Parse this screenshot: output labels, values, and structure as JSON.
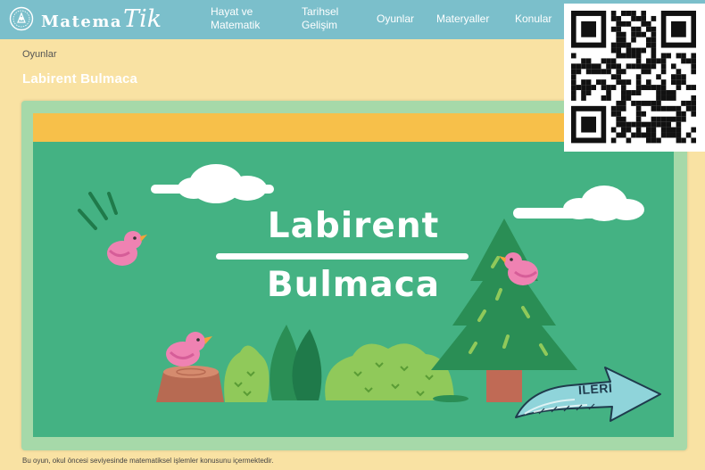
{
  "header": {
    "logo": {
      "main": "Matema",
      "accent": "Tik"
    },
    "nav": [
      {
        "line1": "Hayat ve",
        "line2": "Matematik"
      },
      {
        "line1": "Tarihsel",
        "line2": "Gelişim"
      },
      {
        "line1": "Oyunlar",
        "line2": ""
      },
      {
        "line1": "Materyaller",
        "line2": ""
      },
      {
        "line1": "Konular",
        "line2": ""
      }
    ]
  },
  "breadcrumb": "Oyunlar",
  "page_title": "Labirent Bulmaca",
  "game": {
    "title_line1": "Labirent",
    "title_line2": "Bulmaca",
    "next_button": "İLERİ"
  },
  "footer_note": "Bu oyun, okul öncesi seviyesinde matematiksel işlemler konusunu içermektedir.",
  "colors": {
    "navbar": "#7bbfcb",
    "page_background": "#f9e2a3",
    "game_board": "#44b283",
    "game_band": "#f7c04a",
    "bird": "#ef82b2",
    "tree": "#2a8e55",
    "next_arrow": "#8fd4da"
  },
  "icons": [
    "logo-emblem-icon",
    "bird-icon",
    "cloud-icon",
    "tree-icon",
    "arrow-right-icon",
    "qr-code-icon"
  ]
}
